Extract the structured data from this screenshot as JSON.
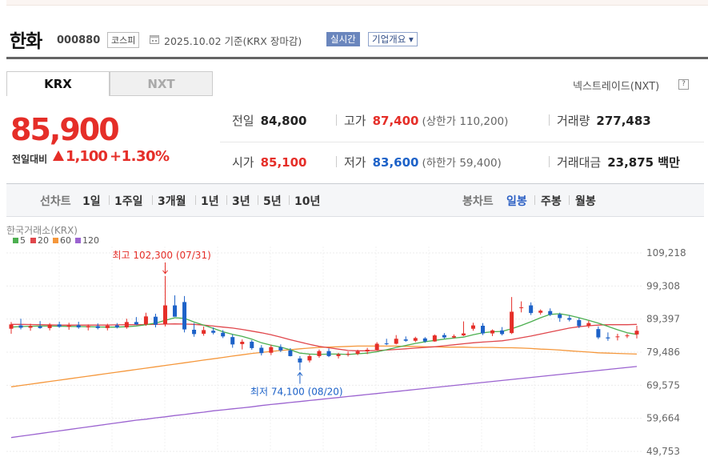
{
  "header": {
    "stock_name": "한화",
    "stock_code": "000880",
    "market": "코스피",
    "date_text": "2025.10.02  기준(KRX 장마감)",
    "realtime_label": "실시간",
    "overview_label": "기업개요 ▾"
  },
  "tabs": [
    {
      "label": "KRX",
      "active": true
    },
    {
      "label": "NXT",
      "active": false
    }
  ],
  "nxt_link": "넥스트레이드(NXT)",
  "help_icon": "?",
  "quote": {
    "price": "85,900",
    "change_label": "전일대비",
    "change_value": "1,100",
    "change_pct": "+1.30%",
    "direction": "up"
  },
  "stats": {
    "prev_close_label": "전일",
    "prev_close": "84,800",
    "high_label": "고가",
    "high": "87,400",
    "upper_limit_label": "(상한가 110,200)",
    "volume_label": "거래량",
    "volume": "277,483",
    "open_label": "시가",
    "open": "85,100",
    "low_label": "저가",
    "low": "83,600",
    "lower_limit_label": "(하한가 59,400)",
    "value_label": "거래대금",
    "value": "23,875 백만"
  },
  "periods": {
    "line_label": "선차트",
    "line_items": [
      "1일",
      "1주일",
      "3개월",
      "1년",
      "3년",
      "5년",
      "10년"
    ],
    "candle_label": "봉차트",
    "candle_items": [
      "일봉",
      "주봉",
      "월봉"
    ],
    "active": "일봉"
  },
  "colors": {
    "up": "#e52e28",
    "down": "#1d62c8",
    "ma5": "#4caf50",
    "ma20": "#e0474c",
    "ma60": "#f5973b",
    "ma120": "#9b63d0",
    "accent": "#2d60c4"
  },
  "chart_data": {
    "type": "candlestick",
    "source_label": "한국거래소(KRX)",
    "legend": [
      {
        "name": "5",
        "color": "#4caf50"
      },
      {
        "name": "20",
        "color": "#e0474c"
      },
      {
        "name": "60",
        "color": "#f5973b"
      },
      {
        "name": "120",
        "color": "#9b63d0"
      }
    ],
    "y_ticks": [
      "109,218",
      "99,308",
      "89,397",
      "79,486",
      "69,575",
      "59,664",
      "49,753"
    ],
    "ylim": [
      49753,
      109218
    ],
    "annotations": {
      "high_label": "최고 102,300 (07/31)",
      "high_value": 102300,
      "high_index": 16,
      "low_label": "최저 74,100 (08/20)",
      "low_value": 74100,
      "low_index": 30
    },
    "candles": [
      {
        "o": 86500,
        "h": 88500,
        "l": 85000,
        "c": 87800
      },
      {
        "o": 87500,
        "h": 89500,
        "l": 86300,
        "c": 86800
      },
      {
        "o": 86800,
        "h": 88000,
        "l": 85900,
        "c": 87300
      },
      {
        "o": 87200,
        "h": 88800,
        "l": 86500,
        "c": 86700
      },
      {
        "o": 86700,
        "h": 88200,
        "l": 86000,
        "c": 87700
      },
      {
        "o": 87800,
        "h": 88600,
        "l": 86800,
        "c": 87100
      },
      {
        "o": 87100,
        "h": 88300,
        "l": 86200,
        "c": 87500
      },
      {
        "o": 87600,
        "h": 88600,
        "l": 86500,
        "c": 86900
      },
      {
        "o": 86900,
        "h": 87800,
        "l": 86000,
        "c": 87300
      },
      {
        "o": 87300,
        "h": 88100,
        "l": 86300,
        "c": 86700
      },
      {
        "o": 86700,
        "h": 88000,
        "l": 86000,
        "c": 87400
      },
      {
        "o": 87500,
        "h": 88200,
        "l": 86600,
        "c": 86900
      },
      {
        "o": 86900,
        "h": 89500,
        "l": 86500,
        "c": 88500
      },
      {
        "o": 88500,
        "h": 90000,
        "l": 87600,
        "c": 87800
      },
      {
        "o": 87800,
        "h": 91300,
        "l": 87400,
        "c": 90200
      },
      {
        "o": 90100,
        "h": 91000,
        "l": 86900,
        "c": 87700
      },
      {
        "o": 87800,
        "h": 102300,
        "l": 87200,
        "c": 93500
      },
      {
        "o": 93500,
        "h": 96500,
        "l": 92200,
        "c": 90100
      },
      {
        "o": 94500,
        "h": 96300,
        "l": 85400,
        "c": 86300
      },
      {
        "o": 86200,
        "h": 88200,
        "l": 84100,
        "c": 84900
      },
      {
        "o": 85000,
        "h": 87200,
        "l": 84400,
        "c": 86100
      },
      {
        "o": 85900,
        "h": 86900,
        "l": 84800,
        "c": 85300
      },
      {
        "o": 85300,
        "h": 86100,
        "l": 83700,
        "c": 84200
      },
      {
        "o": 84000,
        "h": 84800,
        "l": 80800,
        "c": 81800
      },
      {
        "o": 81900,
        "h": 83300,
        "l": 80300,
        "c": 82600
      },
      {
        "o": 82600,
        "h": 83100,
        "l": 80200,
        "c": 80700
      },
      {
        "o": 80800,
        "h": 81600,
        "l": 78500,
        "c": 79200
      },
      {
        "o": 79300,
        "h": 81700,
        "l": 78600,
        "c": 81000
      },
      {
        "o": 81000,
        "h": 81800,
        "l": 79500,
        "c": 80000
      },
      {
        "o": 80000,
        "h": 80700,
        "l": 78200,
        "c": 78300
      },
      {
        "o": 77600,
        "h": 78300,
        "l": 74100,
        "c": 76400
      },
      {
        "o": 77000,
        "h": 78800,
        "l": 76400,
        "c": 78300
      },
      {
        "o": 78300,
        "h": 80300,
        "l": 77800,
        "c": 79800
      },
      {
        "o": 79800,
        "h": 80600,
        "l": 78000,
        "c": 78300
      },
      {
        "o": 78300,
        "h": 79300,
        "l": 77600,
        "c": 78800
      },
      {
        "o": 78900,
        "h": 79700,
        "l": 78200,
        "c": 79000
      },
      {
        "o": 79000,
        "h": 80200,
        "l": 78600,
        "c": 79700
      },
      {
        "o": 79700,
        "h": 80800,
        "l": 78900,
        "c": 80200
      },
      {
        "o": 80200,
        "h": 82500,
        "l": 79900,
        "c": 82000
      },
      {
        "o": 82100,
        "h": 83500,
        "l": 81600,
        "c": 82000
      },
      {
        "o": 82000,
        "h": 84600,
        "l": 81800,
        "c": 83500
      },
      {
        "o": 83300,
        "h": 84200,
        "l": 82600,
        "c": 82900
      },
      {
        "o": 82900,
        "h": 84100,
        "l": 82500,
        "c": 83700
      },
      {
        "o": 83600,
        "h": 84000,
        "l": 82300,
        "c": 82700
      },
      {
        "o": 82700,
        "h": 84800,
        "l": 82600,
        "c": 84500
      },
      {
        "o": 84600,
        "h": 85200,
        "l": 83500,
        "c": 83900
      },
      {
        "o": 83900,
        "h": 84800,
        "l": 83600,
        "c": 84300
      },
      {
        "o": 84500,
        "h": 88700,
        "l": 84300,
        "c": 85100
      },
      {
        "o": 86500,
        "h": 88300,
        "l": 85900,
        "c": 87500
      },
      {
        "o": 87400,
        "h": 88200,
        "l": 84600,
        "c": 85100
      },
      {
        "o": 85100,
        "h": 86300,
        "l": 84300,
        "c": 86000
      },
      {
        "o": 86000,
        "h": 87000,
        "l": 84500,
        "c": 84900
      },
      {
        "o": 85200,
        "h": 96000,
        "l": 84900,
        "c": 91600
      },
      {
        "o": 92800,
        "h": 94700,
        "l": 91400,
        "c": 92900
      },
      {
        "o": 93500,
        "h": 94400,
        "l": 90600,
        "c": 91200
      },
      {
        "o": 91300,
        "h": 92300,
        "l": 90700,
        "c": 91900
      },
      {
        "o": 91800,
        "h": 92600,
        "l": 90300,
        "c": 90700
      },
      {
        "o": 90800,
        "h": 91300,
        "l": 88600,
        "c": 89700
      },
      {
        "o": 89700,
        "h": 90600,
        "l": 88700,
        "c": 89200
      },
      {
        "o": 89100,
        "h": 89700,
        "l": 86700,
        "c": 87300
      },
      {
        "o": 87300,
        "h": 88900,
        "l": 86700,
        "c": 88200
      },
      {
        "o": 86400,
        "h": 87200,
        "l": 83400,
        "c": 83900
      },
      {
        "o": 83900,
        "h": 85400,
        "l": 82900,
        "c": 83600
      },
      {
        "o": 84000,
        "h": 85000,
        "l": 83000,
        "c": 84200
      },
      {
        "o": 84300,
        "h": 85000,
        "l": 83700,
        "c": 84500
      },
      {
        "o": 84800,
        "h": 87400,
        "l": 83600,
        "c": 85900
      }
    ],
    "ma_series": [
      {
        "name": "5",
        "values": [
          87000,
          87150,
          87250,
          87300,
          87300,
          87250,
          87200,
          87150,
          87100,
          87050,
          87000,
          87000,
          87100,
          87300,
          87700,
          88200,
          89000,
          89800,
          89600,
          88500,
          87600,
          86600,
          85600,
          84800,
          84200,
          83400,
          82300,
          81600,
          81000,
          80200,
          79200,
          78900,
          78800,
          78900,
          78900,
          78800,
          79000,
          79200,
          79600,
          80200,
          80900,
          81500,
          82100,
          82600,
          83000,
          83400,
          83700,
          84000,
          84700,
          85300,
          85600,
          85700,
          86500,
          87500,
          88600,
          89800,
          90800,
          91000,
          90500,
          89800,
          89000,
          88200,
          87200,
          86200,
          85300,
          84800
        ]
      },
      {
        "name": "20",
        "values": [
          87800,
          87800,
          87750,
          87700,
          87650,
          87600,
          87600,
          87600,
          87600,
          87600,
          87600,
          87650,
          87700,
          87700,
          87750,
          87800,
          87900,
          87950,
          87900,
          87800,
          87600,
          87300,
          87000,
          86700,
          86300,
          85800,
          85300,
          84700,
          84000,
          83200,
          82500,
          81800,
          81200,
          80800,
          80400,
          80000,
          79900,
          79900,
          80000,
          80100,
          80300,
          80500,
          80700,
          80900,
          81100,
          81400,
          81700,
          82000,
          82300,
          82500,
          82700,
          82900,
          83300,
          83800,
          84300,
          84900,
          85500,
          86100,
          86700,
          87100,
          87400,
          87600,
          87700,
          87700,
          87700,
          87800
        ]
      },
      {
        "name": "60",
        "values": [
          69100,
          69500,
          69900,
          70300,
          70700,
          71100,
          71500,
          71900,
          72300,
          72700,
          73100,
          73500,
          73900,
          74300,
          74700,
          75100,
          75500,
          75900,
          76300,
          76700,
          77100,
          77500,
          77900,
          78300,
          78700,
          79100,
          79400,
          79700,
          80000,
          80200,
          80500,
          80700,
          80900,
          81000,
          81100,
          81200,
          81300,
          81300,
          81300,
          81300,
          81300,
          81200,
          81200,
          81100,
          81100,
          81000,
          81000,
          81000,
          80900,
          80900,
          80900,
          80800,
          80800,
          80700,
          80600,
          80400,
          80300,
          80100,
          79900,
          79700,
          79500,
          79300,
          79200,
          79100,
          79000,
          78900
        ]
      },
      {
        "name": "120",
        "values": [
          53900,
          54300,
          54700,
          55100,
          55500,
          55900,
          56300,
          56700,
          57100,
          57500,
          57900,
          58300,
          58700,
          59100,
          59400,
          59800,
          60100,
          60500,
          60800,
          61200,
          61500,
          61900,
          62200,
          62500,
          62800,
          63100,
          63500,
          63800,
          64100,
          64400,
          64700,
          65000,
          65300,
          65600,
          65900,
          66200,
          66500,
          66800,
          67100,
          67400,
          67700,
          68000,
          68300,
          68600,
          68900,
          69200,
          69500,
          69800,
          70100,
          70400,
          70700,
          71000,
          71300,
          71600,
          71900,
          72200,
          72500,
          72800,
          73100,
          73400,
          73700,
          74000,
          74300,
          74600,
          74900,
          75200
        ]
      }
    ]
  }
}
